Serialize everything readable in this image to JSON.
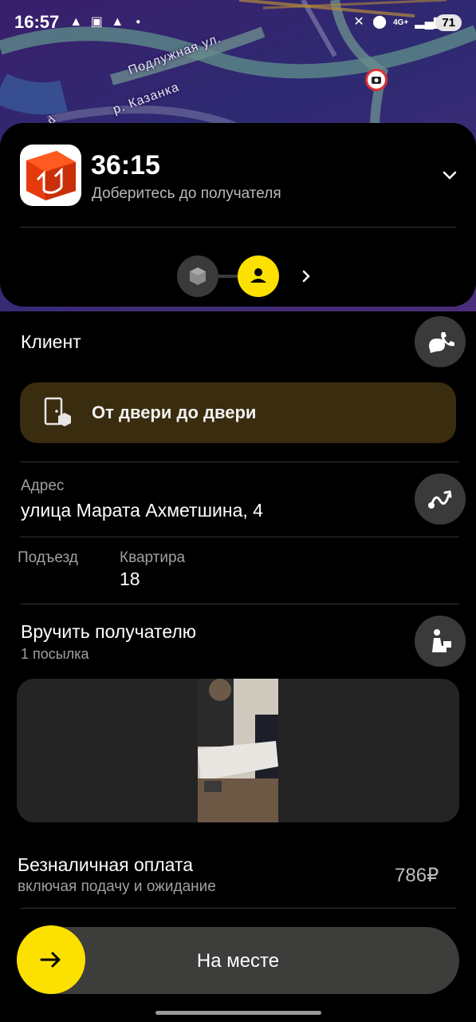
{
  "status_bar": {
    "time": "16:57",
    "network": "4G+",
    "battery": "71"
  },
  "map": {
    "street_1": "Подлужная ул.",
    "street_2": "р. Казанка",
    "street_3": "d"
  },
  "order": {
    "timer": "36:15",
    "timer_subtitle": "Доберитесь до получателя"
  },
  "client": {
    "title": "Клиент"
  },
  "door_banner": {
    "label": "От двери до двери"
  },
  "address": {
    "label": "Адрес",
    "value": "улица Марата Ахметшина, 4"
  },
  "details": {
    "entrance_label": "Подъезд",
    "entrance_value": "",
    "apartment_label": "Квартира",
    "apartment_value": "18"
  },
  "handover": {
    "title": "Вручить получателю",
    "subtitle": "1 посылка"
  },
  "payment": {
    "title": "Безналичная оплата",
    "subtitle": "включая подачу и ожидание",
    "price": "786₽"
  },
  "action": {
    "label": "На месте"
  },
  "colors": {
    "accent": "#fce000",
    "banner": "#3a2c0e",
    "button_bg": "#3a3a3a"
  }
}
